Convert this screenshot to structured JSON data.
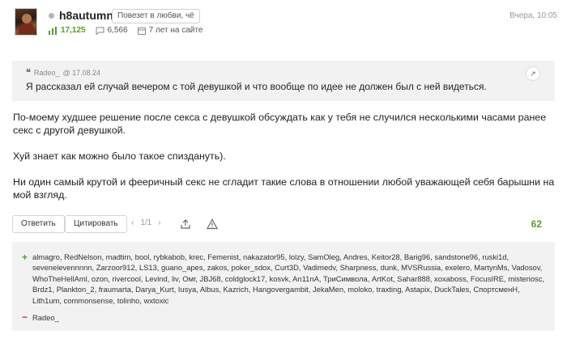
{
  "author": {
    "name": "h8autumn",
    "status": "Повезет в любви, чё",
    "rating": "17,125",
    "messages": "6,566",
    "tenure": "7 лет на сайте"
  },
  "post": {
    "time": "Вчера, 10:05",
    "quote": {
      "author": "Radeo_",
      "date": "@ 17.08.24",
      "text": "Я рассказал ей случай вечером с той девушкой и что вообще по идее не должен был с ней видеться."
    },
    "paragraphs": [
      "По-моему худшее решение после секса с девушкой обсуждать как у тебя не случился несколькими часами ранее секс с другой девушкой.",
      "Хуй знает как можно было такое спиздануть).",
      "Ни один самый крутой и фееричный секс не сгладит такие слова в отношении любой уважающей себя барышни на мой взгляд."
    ],
    "score": "62"
  },
  "actions": {
    "reply": "Ответить",
    "quote": "Цитировать",
    "pager": "1/1",
    "prev": "‹",
    "next": "›"
  },
  "votes": {
    "plus_sign": "+",
    "minus_sign": "−",
    "plus": "almagro, RedNelson, madtim, bool, rybkabob, krec, Femenist, nakazator95, lolzy, SamOleg, Andres, Keitor28, Barig96, sandstone96, ruski1d, sevenelevennnnn, Zarzoor912, LS13, guano_apes, zakos, poker_sdox, Curt3D, Vadimedv, Sharpness, dunk, MVSRussia, exelero, MartynMs, Vadosov, WhoTheHellAml, ozon, rivercool, Levind, liv, Омг, JBJ68, coldglock17, kosvk, An11nA, ТриСимвола, ArtKot, Sahar888, xoxaboss, FocusIRE, misteriosc, Brdz1, Plankton_2, fraumarta, Darya_Kurt, Iusya, Albus, Kazrich, Hangovergambit, JekaMen, moloko, traxting, Astapix, DuckTales, СпортсменН, Lith1um, commonsense, tolinho, wxtoxic",
    "minus": "Radeo_"
  }
}
